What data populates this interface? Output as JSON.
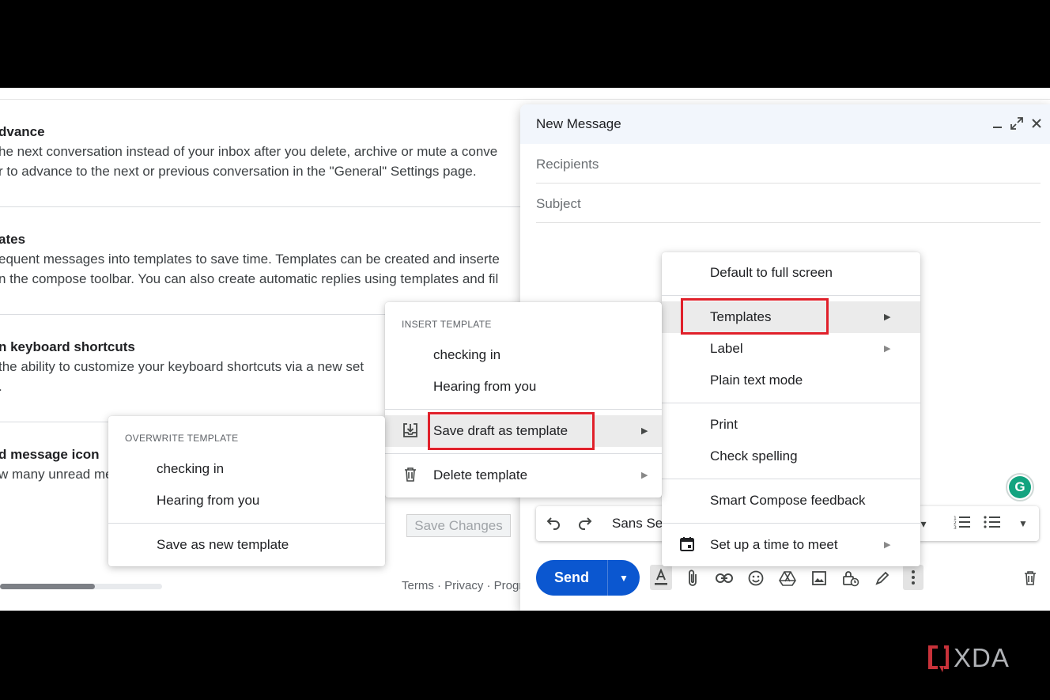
{
  "settings": {
    "rows": [
      {
        "title": "dvance",
        "lines": [
          "he next conversation instead of your inbox after you delete, archive or mute a conve",
          "r to advance to the next or previous conversation in the \"General\" Settings page."
        ]
      },
      {
        "title": "ates",
        "lines": [
          "equent messages into templates to save time. Templates can be created and inserte",
          "n the compose toolbar. You can also create automatic replies using templates and fil"
        ]
      },
      {
        "title": "n keyboard shortcuts",
        "lines": [
          "the ability to customize your keyboard shortcuts via a new set",
          "."
        ]
      },
      {
        "title": "d message icon",
        "lines": [
          "w many unread me"
        ]
      }
    ],
    "save_changes_label": "Save Changes",
    "footer_links": "Terms · Privacy · Progr"
  },
  "compose": {
    "title": "New Message",
    "header_icons": [
      "minimize-icon",
      "expand-icon",
      "close-icon"
    ],
    "recipients_placeholder": "Recipients",
    "subject_placeholder": "Subject",
    "font_name": "Sans Se",
    "send_label": "Send",
    "grammarly_letter": "G",
    "toolbar_icons": [
      "text-format-icon",
      "attach-icon",
      "link-icon",
      "emoji-icon",
      "drive-icon",
      "photo-icon",
      "confidential-icon",
      "signature-icon",
      "more-options-icon",
      "trash-icon"
    ]
  },
  "more_menu": {
    "items": [
      "Default to full screen",
      "Templates",
      "Label",
      "Plain text mode",
      "Print",
      "Check spelling",
      "Smart Compose feedback",
      "Set up a time to meet"
    ]
  },
  "templates_menu": {
    "insert_heading": "INSERT TEMPLATE",
    "insert_items": [
      "checking in",
      "Hearing from you"
    ],
    "save_draft_label": "Save draft as template",
    "delete_label": "Delete template"
  },
  "overwrite_menu": {
    "heading": "OVERWRITE TEMPLATE",
    "items": [
      "checking in",
      "Hearing from you"
    ],
    "save_new_label": "Save as new template"
  },
  "watermark": "XDA",
  "colors": {
    "highlight_box": "#e0202a",
    "send_button": "#0b57d0",
    "compose_header": "#f2f6fc"
  }
}
